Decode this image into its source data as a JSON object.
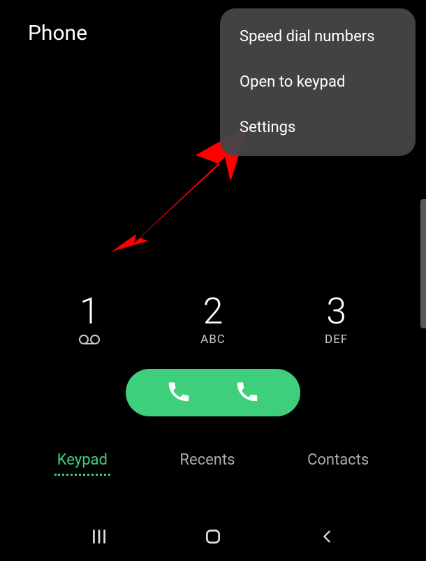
{
  "header": {
    "title": "Phone"
  },
  "menu": {
    "items": [
      {
        "label": "Speed dial numbers"
      },
      {
        "label": "Open to keypad"
      },
      {
        "label": "Settings"
      }
    ]
  },
  "keypad": {
    "keys": [
      {
        "digit": "1",
        "sub": "voicemail"
      },
      {
        "digit": "2",
        "sub": "ABC"
      },
      {
        "digit": "3",
        "sub": "DEF"
      }
    ]
  },
  "tabs": {
    "items": [
      {
        "label": "Keypad",
        "active": true
      },
      {
        "label": "Recents",
        "active": false
      },
      {
        "label": "Contacts",
        "active": false
      }
    ]
  },
  "colors": {
    "accent": "#3ecf7c",
    "annotation": "#ff0000"
  }
}
